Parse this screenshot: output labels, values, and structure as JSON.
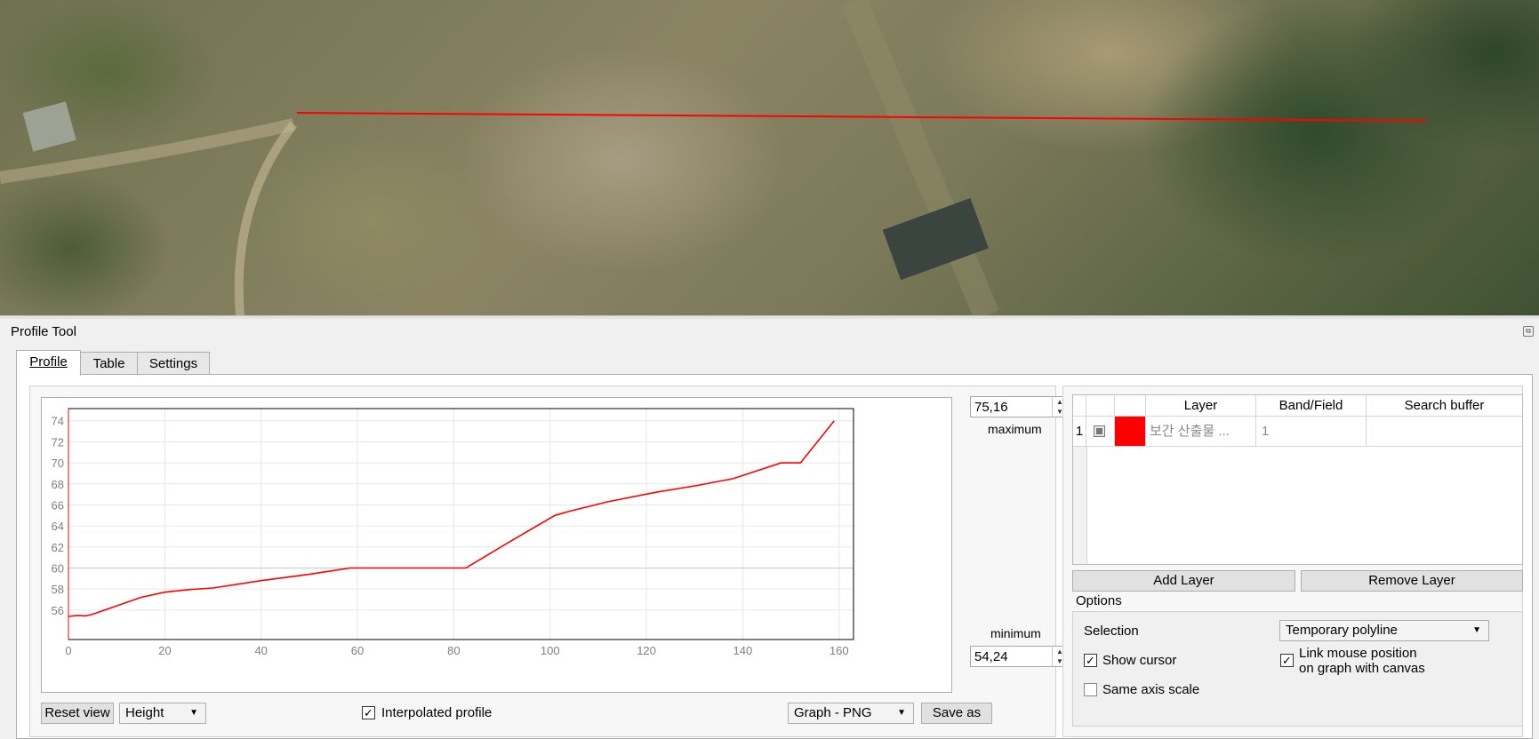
{
  "dock": {
    "title": "Profile Tool"
  },
  "tabs": [
    {
      "label": "Profile"
    },
    {
      "label": "Table"
    },
    {
      "label": "Settings"
    }
  ],
  "range": {
    "max_value": "75,16",
    "max_label": "maximum",
    "min_value": "54,24",
    "min_label": "minimum"
  },
  "bottom": {
    "reset_label": "Reset view",
    "mode_value": "Height",
    "interpolated_label": "Interpolated profile",
    "interpolated_checked": true,
    "export_value": "Graph - PNG",
    "save_label": "Save as"
  },
  "layers": {
    "headers": [
      "Layer",
      "Band/Field",
      "Search buffer"
    ],
    "rows": [
      {
        "index": "1",
        "color": "#ff0000",
        "layer": "보간 산출물 ...",
        "band": "1",
        "buffer": ""
      }
    ]
  },
  "buttons": {
    "add_layer": "Add Layer",
    "remove_layer": "Remove Layer"
  },
  "options": {
    "title": "Options",
    "selection_label": "Selection",
    "selection_value": "Temporary polyline",
    "show_cursor_label": "Show cursor",
    "show_cursor_checked": true,
    "link_label_1": "Link mouse position",
    "link_label_2": "on graph with canvas",
    "link_checked": true,
    "same_axis_label": "Same axis scale",
    "same_axis_checked": false
  },
  "colors": {
    "profile_line": "#ff0000",
    "grid": "#e6e6e6",
    "tick_text": "#7f7f7f"
  },
  "chart_data": {
    "type": "line",
    "xlabel": "",
    "ylabel": "",
    "xlim": [
      0,
      163
    ],
    "ylim": [
      53.2,
      75.16
    ],
    "x_ticks": [
      0,
      20,
      40,
      60,
      80,
      100,
      120,
      140,
      160
    ],
    "y_ticks": [
      56,
      58,
      60,
      62,
      64,
      66,
      68,
      70,
      72,
      74
    ],
    "grid": true,
    "series": [
      {
        "points": [
          [
            0,
            55.4
          ],
          [
            2,
            55.5
          ],
          [
            3.5,
            55.45
          ],
          [
            5,
            55.6
          ],
          [
            10,
            56.4
          ],
          [
            15,
            57.2
          ],
          [
            20,
            57.7
          ],
          [
            25,
            57.95
          ],
          [
            30,
            58.1
          ],
          [
            40,
            58.8
          ],
          [
            50,
            59.4
          ],
          [
            58.5,
            60.0
          ],
          [
            70,
            60.0
          ],
          [
            82.5,
            60.0
          ],
          [
            92,
            62.6
          ],
          [
            101,
            65.0
          ],
          [
            104,
            65.4
          ],
          [
            112,
            66.3
          ],
          [
            122,
            67.2
          ],
          [
            130,
            67.8
          ],
          [
            138,
            68.5
          ],
          [
            148,
            70.0
          ],
          [
            152,
            70.0
          ],
          [
            159,
            74.0
          ]
        ]
      }
    ]
  }
}
